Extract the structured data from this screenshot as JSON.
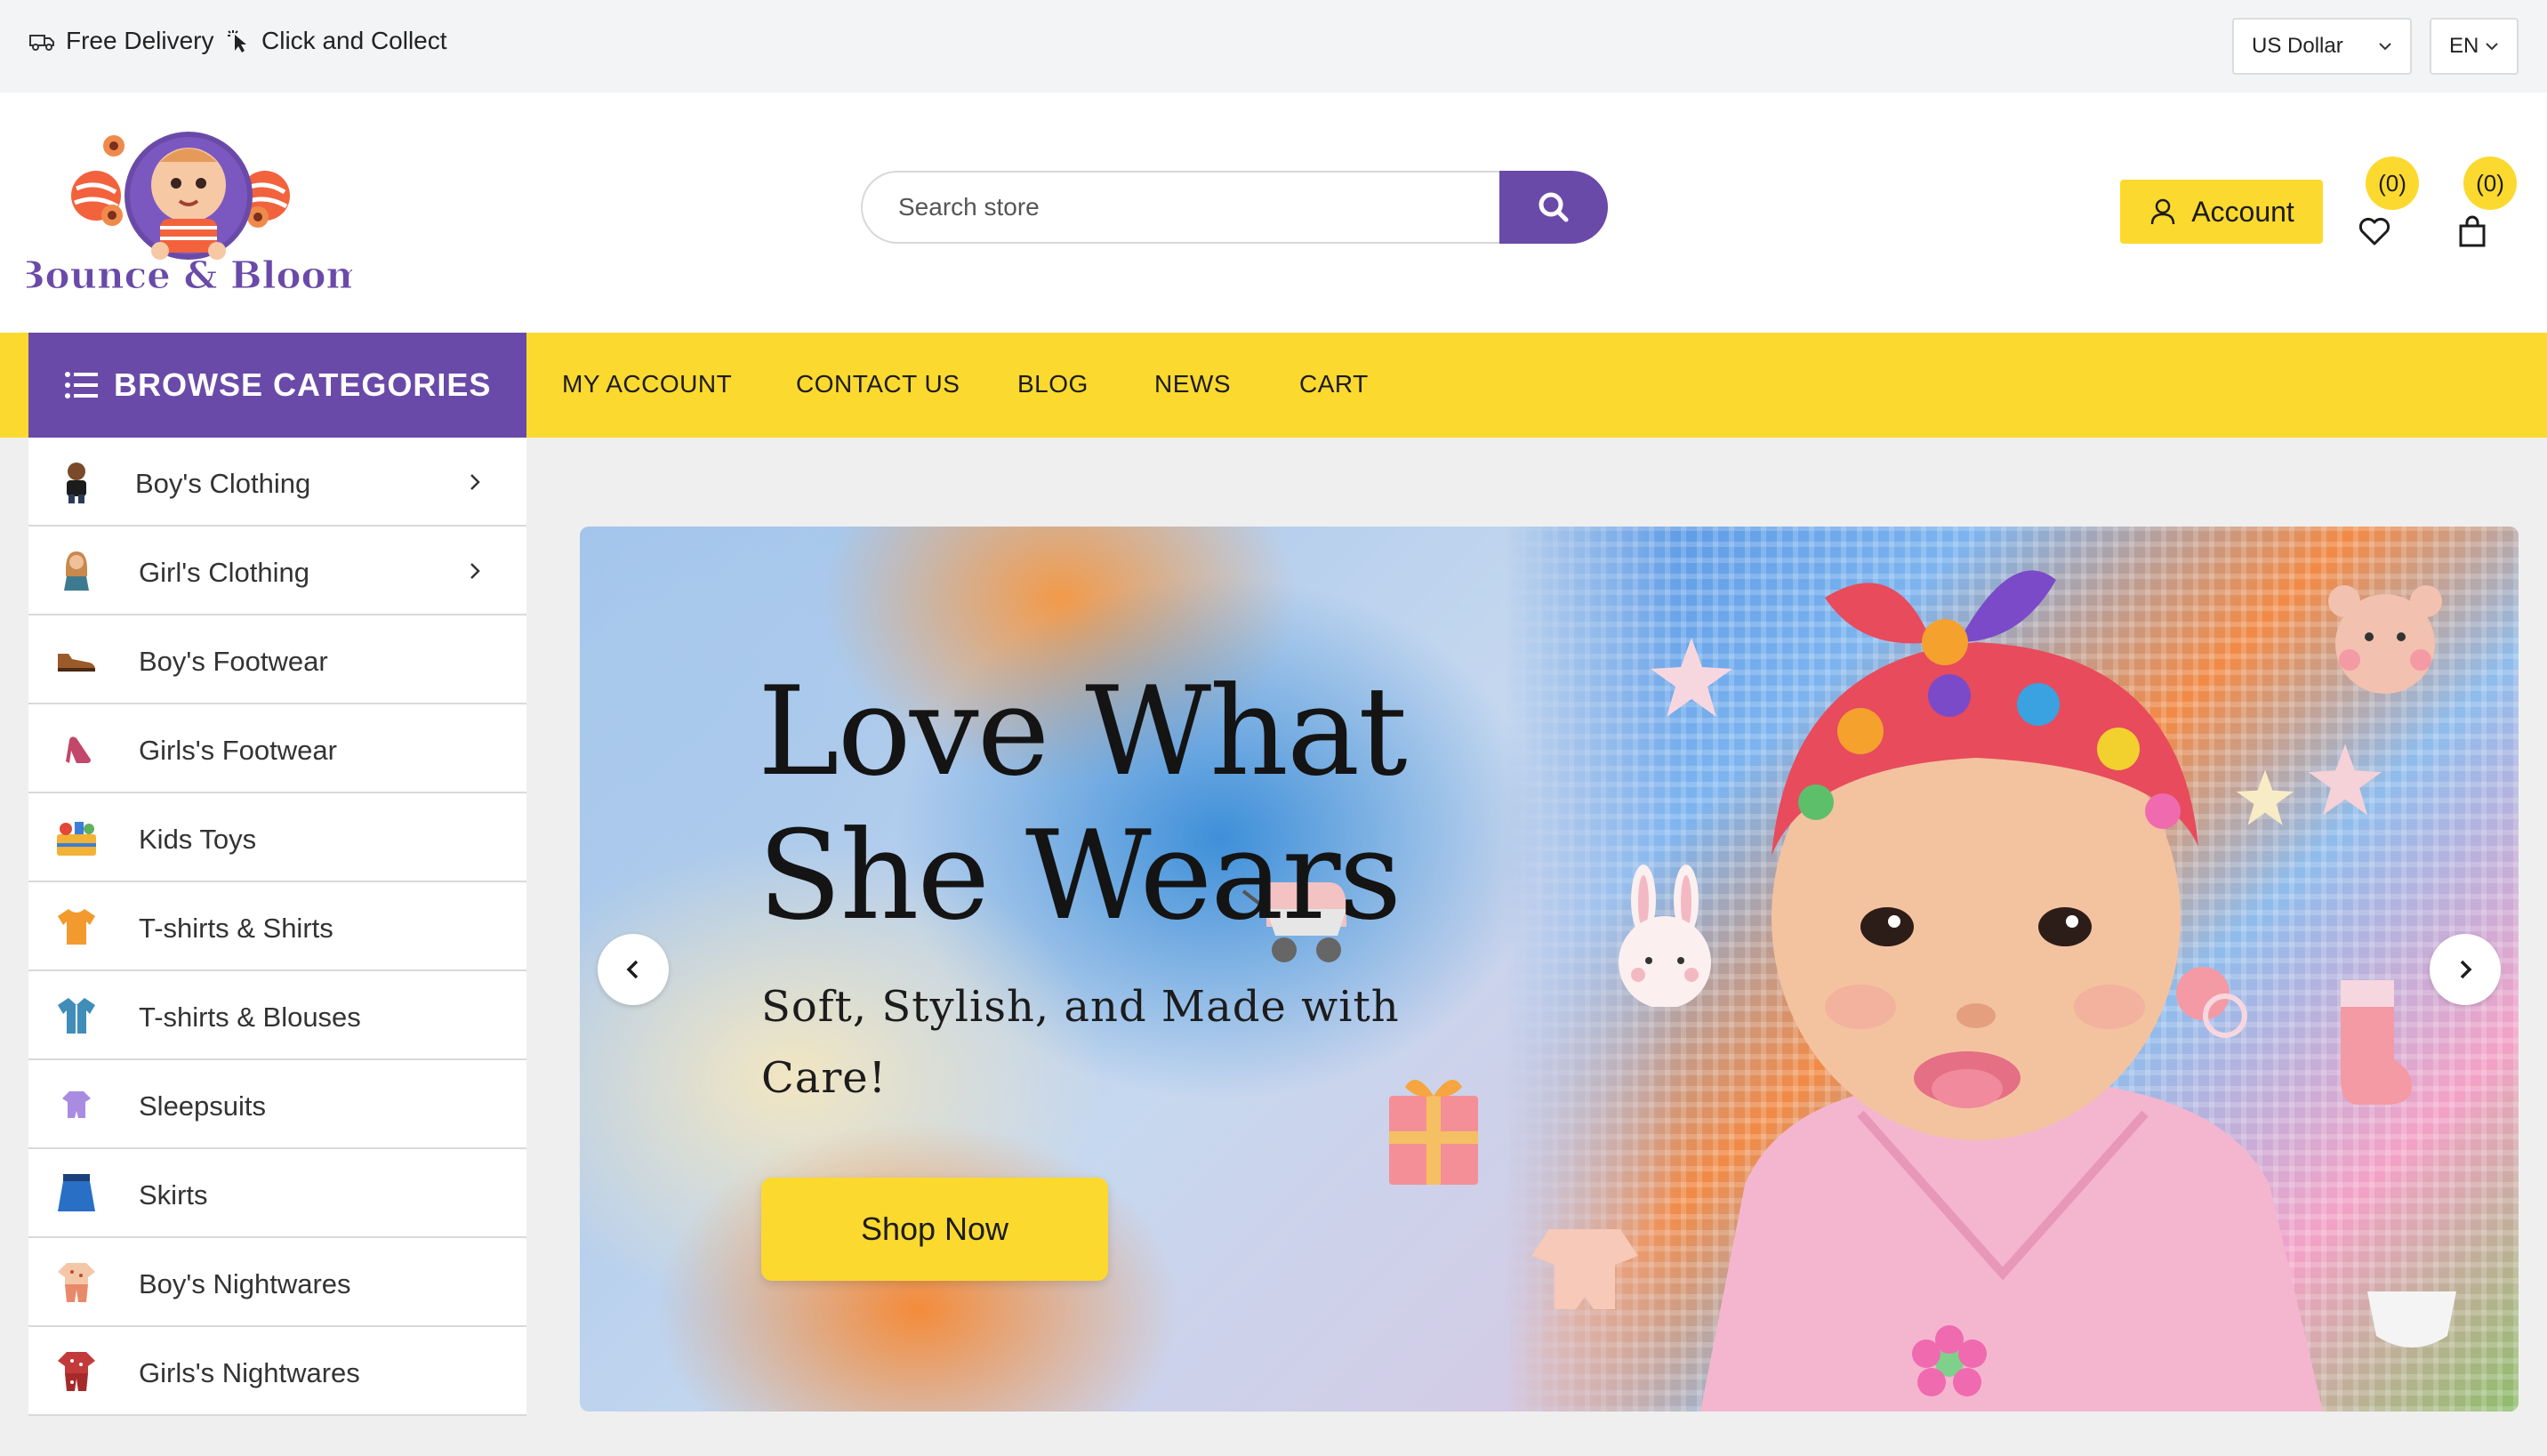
{
  "topbar": {
    "promo_delivery": "Free Delivery",
    "promo_collect": "Click and Collect",
    "currency_selected": "US Dollar",
    "language_selected": "EN"
  },
  "header": {
    "logo_text": "Bounce & Bloom",
    "search_placeholder": "Search store",
    "account_label": "Account",
    "wishlist_count": "(0)",
    "cart_count": "(0)"
  },
  "nav": {
    "browse_label": "BROWSE CATEGORIES",
    "links": [
      "MY ACCOUNT",
      "CONTACT US",
      "BLOG",
      "NEWS",
      "CART"
    ]
  },
  "categories": [
    {
      "label": "Boy's Clothing",
      "icon": "boy-icon",
      "has_submenu": true
    },
    {
      "label": "Girl's Clothing",
      "icon": "girl-icon",
      "has_submenu": true
    },
    {
      "label": "Boy's Footwear",
      "icon": "shoe-icon",
      "has_submenu": false
    },
    {
      "label": "Girls's Footwear",
      "icon": "high-heel-icon",
      "has_submenu": false
    },
    {
      "label": "Kids Toys",
      "icon": "toys-icon",
      "has_submenu": false
    },
    {
      "label": "T-shirts & Shirts",
      "icon": "tshirt-icon",
      "has_submenu": false
    },
    {
      "label": "T-shirts & Blouses",
      "icon": "blouse-icon",
      "has_submenu": false
    },
    {
      "label": "Sleepsuits",
      "icon": "sleepsuit-icon",
      "has_submenu": false
    },
    {
      "label": "Skirts",
      "icon": "skirt-icon",
      "has_submenu": false
    },
    {
      "label": "Boy's Nightwares",
      "icon": "boy-nightwear-icon",
      "has_submenu": false
    },
    {
      "label": "Girls's Nightwares",
      "icon": "girl-nightwear-icon",
      "has_submenu": false
    }
  ],
  "banner": {
    "title": "Love What She Wears",
    "subtitle": "Soft, Stylish, and Made with Care!",
    "cta_label": "Shop Now"
  },
  "colors": {
    "brand_purple": "#6a4aa8",
    "brand_yellow": "#fcd92e",
    "topbar_bg": "#f3f4f6"
  }
}
